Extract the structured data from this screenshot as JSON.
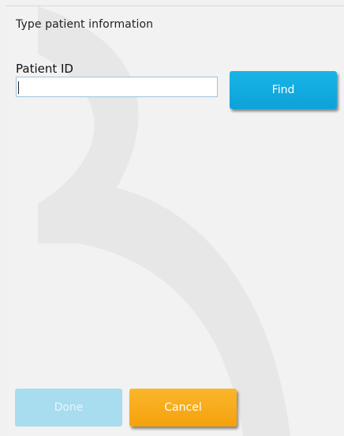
{
  "dialog": {
    "title": "Type patient information",
    "patient_id_label": "Patient ID",
    "patient_id_value": "",
    "patient_id_placeholder": ""
  },
  "buttons": {
    "find_label": "Find",
    "done_label": "Done",
    "cancel_label": "Cancel"
  },
  "colors": {
    "find": "#0da2d8",
    "done_disabled": "#a8dcef",
    "cancel": "#f4a20d",
    "background": "#f2f2f2"
  },
  "state": {
    "done_enabled": false,
    "patient_id_focused": true
  }
}
